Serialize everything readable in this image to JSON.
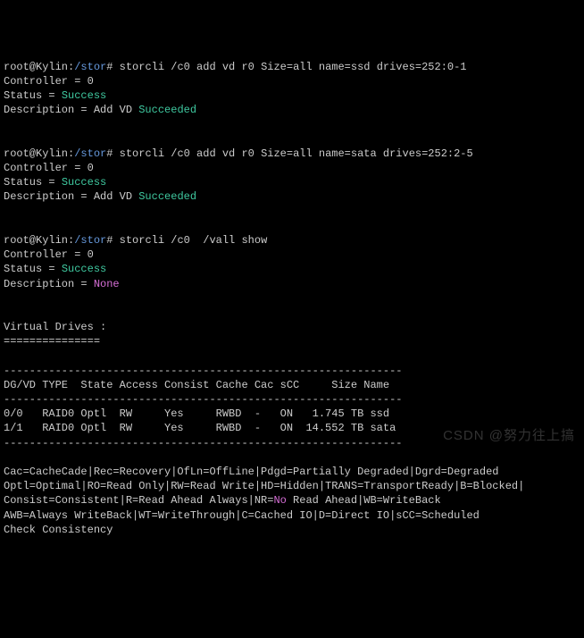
{
  "block1": {
    "prompt_user": "root@Kylin",
    "prompt_sep": ":",
    "prompt_path": "/stor",
    "prompt_end": "# ",
    "cmd": "storcli /c0 add vd r0 Size=all name=ssd drives=252:0-1",
    "controller": "Controller = 0",
    "status_lbl": "Status = ",
    "status_val": "Success",
    "desc_lbl": "Description = Add VD ",
    "desc_val": "Succeeded"
  },
  "block2": {
    "prompt_user": "root@Kylin",
    "prompt_sep": ":",
    "prompt_path": "/stor",
    "prompt_end": "# ",
    "cmd": "storcli /c0 add vd r0 Size=all name=sata drives=252:2-5",
    "controller": "Controller = 0",
    "status_lbl": "Status = ",
    "status_val": "Success",
    "desc_lbl": "Description = Add VD ",
    "desc_val": "Succeeded"
  },
  "block3": {
    "prompt_user": "root@Kylin",
    "prompt_sep": ":",
    "prompt_path": "/stor",
    "prompt_end": "# ",
    "cmd": "storcli /c0  /vall show",
    "controller": "Controller = 0",
    "status_lbl": "Status = ",
    "status_val": "Success",
    "desc_lbl": "Description = ",
    "desc_val": "None"
  },
  "vd": {
    "title": "Virtual Drives :",
    "underline": "===============",
    "sep_top": "--------------------------------------------------------------",
    "header": "DG/VD TYPE  State Access Consist Cache Cac sCC     Size Name",
    "sep_mid": "--------------------------------------------------------------",
    "row0": "0/0   RAID0 Optl  RW     Yes     RWBD  -   ON   1.745 TB ssd",
    "row1": "1/1   RAID0 Optl  RW     Yes     RWBD  -   ON  14.552 TB sata",
    "sep_bot": "--------------------------------------------------------------"
  },
  "legend": {
    "l1": "Cac=CacheCade|Rec=Recovery|OfLn=OffLine|Pdgd=Partially Degraded|Dgrd=Degraded",
    "l2": "Optl=Optimal|RO=Read Only|RW=Read Write|HD=Hidden|TRANS=TransportReady|B=Blocked|",
    "l3a": "Consist=Consistent|R=Read Ahead Always|NR=",
    "l3b": "No",
    "l3c": " Read Ahead|WB=WriteBack",
    "l4": "AWB=Always WriteBack|WT=WriteThrough|C=Cached IO|D=Direct IO|sCC=Scheduled",
    "l5": "Check Consistency"
  },
  "watermark": "CSDN @努力往上搞"
}
